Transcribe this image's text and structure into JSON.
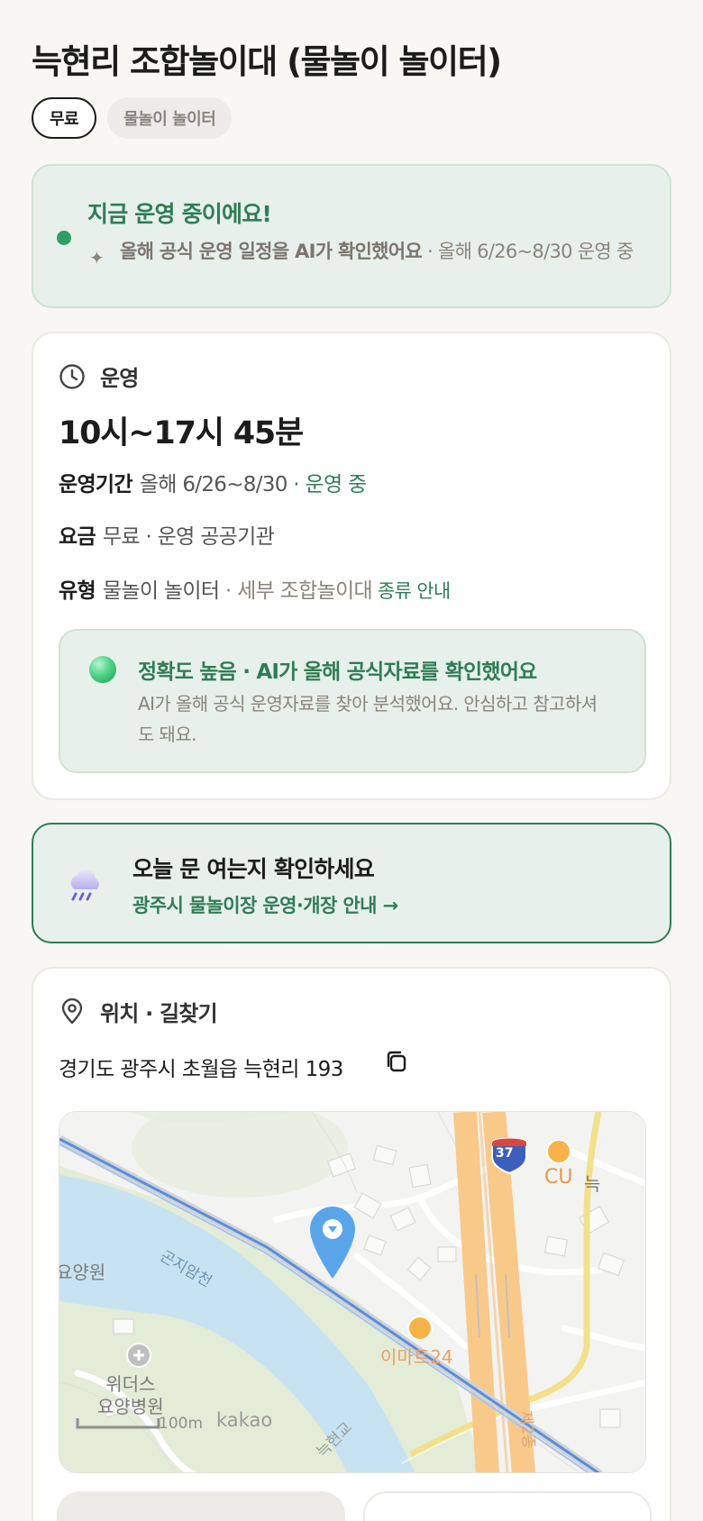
{
  "header": {
    "title": "늑현리 조합놀이대 (물놀이 놀이터)",
    "tags": [
      "무료",
      "물놀이 놀이터"
    ]
  },
  "status": {
    "title": "지금 운영 중이에요!",
    "detail_strong": "올해 공식 운영 일정을 AI가 확인했어요",
    "detail_rest": " · 올해 6/26~8/30 운영 중"
  },
  "operation": {
    "section_label": "운영",
    "hours": "10시~17시 45분",
    "period_key": "운영기간",
    "period_value": "올해 6/26~8/30",
    "period_status": "· 운영 중",
    "fee_key": "요금",
    "fee_value": "무료 · 운영 공공기관",
    "type_key": "유형",
    "type_value": "물놀이 놀이터",
    "type_detail": "· 세부 조합놀이대",
    "type_link": "종류 안내",
    "accuracy_title": "정확도 높음 · AI가 올해 공식자료를 확인했어요",
    "accuracy_body": "AI가 올해 공식 운영자료를 찾아 분석했어요. 안심하고 참고하셔도 돼요."
  },
  "notice": {
    "title": "오늘 문 여는지 확인하세요",
    "link": "광주시 물놀이장 운영·개장 안내 →"
  },
  "location": {
    "section_label": "위치 · 길찾기",
    "address": "경기도 광주시 초월읍 늑현리 193"
  },
  "map": {
    "labels": {
      "river": "곤지암천",
      "nursing_home_partial": "요양원",
      "hospital": "위더스\n요양병원",
      "cu": "CU",
      "neuk_partial": "늑",
      "emart24": "이마트24",
      "route_shield": "37",
      "scale": "100m",
      "brand": "kakao",
      "bridge_partial": "늑현교",
      "road_partial": "제2종"
    },
    "colors": {
      "water": "#c7e3f2",
      "green": "#e3ecd7",
      "highway": "#f9c98a",
      "pin": "#5aa5ea",
      "rail": "#5a8fd9"
    }
  }
}
